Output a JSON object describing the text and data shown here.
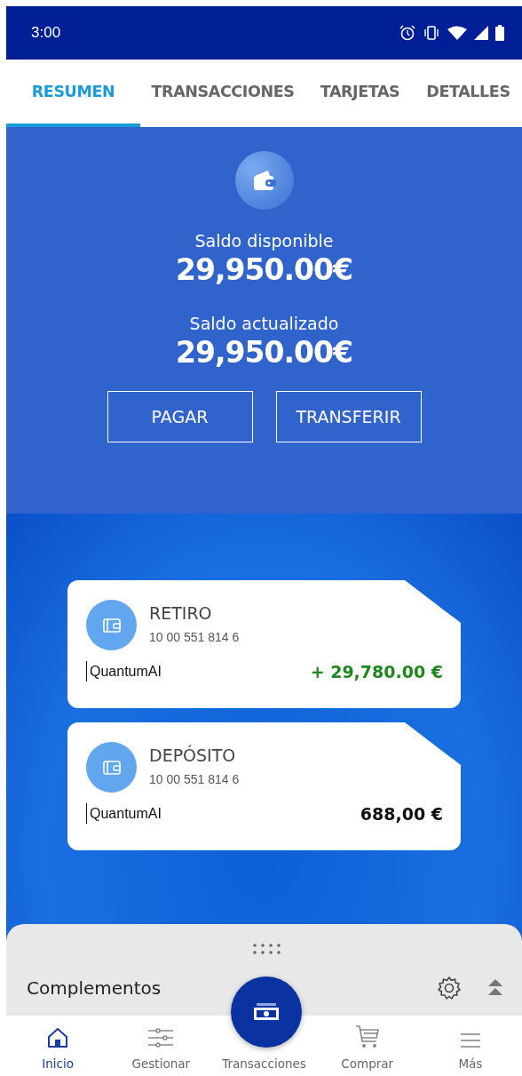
{
  "status_bar": {
    "time": "3:00"
  },
  "tabs": [
    {
      "label": "RESUMEN",
      "selected": true
    },
    {
      "label": "TRANSACCIONES",
      "selected": false
    },
    {
      "label": "TARJETAS",
      "selected": false
    },
    {
      "label": "DETALLES",
      "selected": false
    }
  ],
  "summary": {
    "balances": [
      {
        "label": "Saldo disponible",
        "amount": "29,950.00€"
      },
      {
        "label": "Saldo actualizado",
        "amount": "29,950.00€"
      }
    ],
    "buttons": [
      "PAGAR",
      "TRANSFERIR"
    ]
  },
  "accounts": [
    {
      "name": "RETIRO",
      "number": "10 00 551 814 6",
      "brand": "QuantumAI",
      "amount": "+ 29,780.00 €",
      "kind": "credit"
    },
    {
      "name": "DEPÓSITO",
      "number": "10 00 551 814 6",
      "brand": "QuantumAI",
      "amount": "688,00 €",
      "kind": "balance"
    }
  ],
  "sheet": {
    "title": "Complementos"
  },
  "nav": [
    {
      "label": "Inicio",
      "kind": "home",
      "selected": true
    },
    {
      "label": "Gestionar",
      "kind": "sliders",
      "selected": false
    },
    {
      "label": "Transacciones",
      "kind": "cash",
      "selected": false
    },
    {
      "label": "Comprar",
      "kind": "cart",
      "selected": false
    },
    {
      "label": "Más",
      "kind": "menu",
      "selected": false
    }
  ]
}
